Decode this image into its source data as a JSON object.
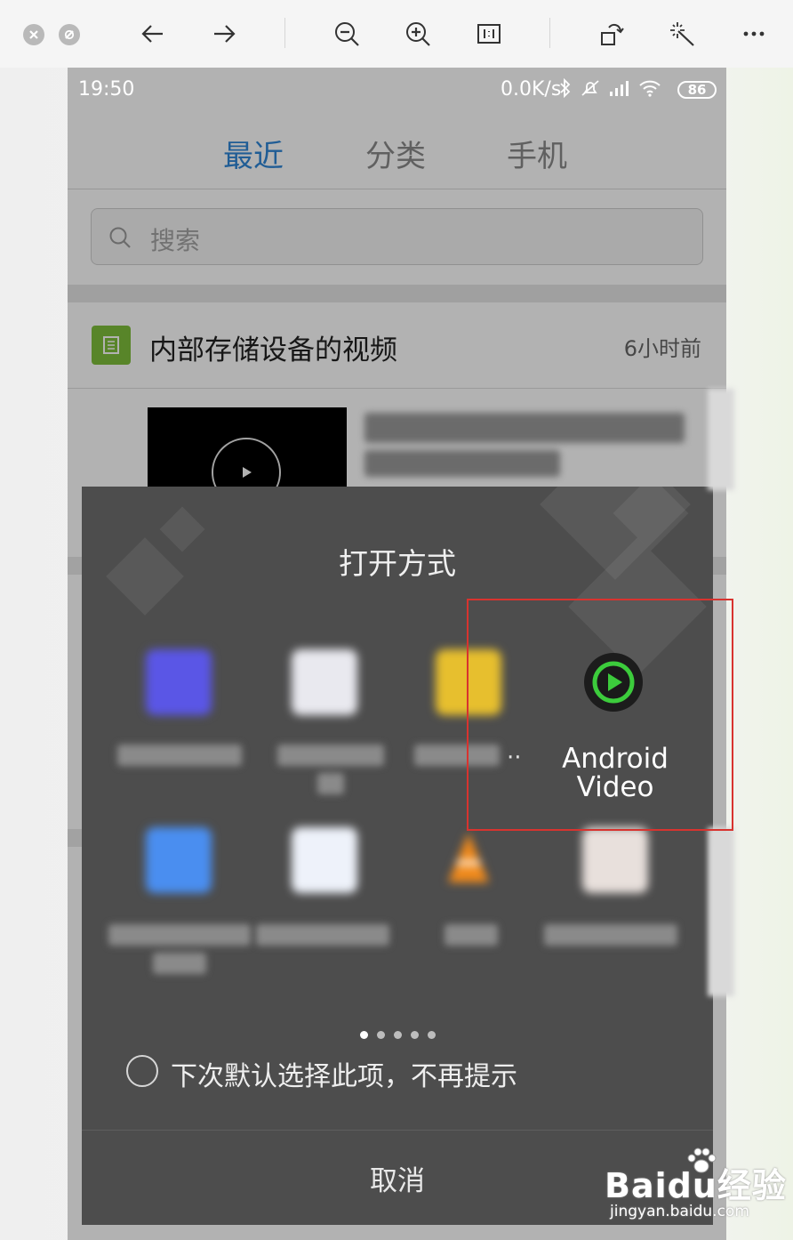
{
  "toolbar": {
    "buttons": [
      "close-icon",
      "stop-icon",
      "back-arrow-icon",
      "forward-arrow-icon",
      "zoom-out-icon",
      "zoom-in-icon",
      "actual-size-icon",
      "rotate-icon",
      "magic-wand-icon",
      "more-icon"
    ]
  },
  "status_bar": {
    "time": "19:50",
    "speed": "0.0K/s",
    "battery": "86"
  },
  "tabs": [
    {
      "label": "最近",
      "active": true
    },
    {
      "label": "分类",
      "active": false
    },
    {
      "label": "手机",
      "active": false
    }
  ],
  "search": {
    "placeholder": "搜索"
  },
  "group": {
    "title": "内部存储设备的视频",
    "time": "6小时前"
  },
  "dialog": {
    "title": "打开方式",
    "apps": [
      {
        "label": "Android Video",
        "icon": "play-circle-icon",
        "color": "#3ccc3c"
      }
    ],
    "ellipsis": "··",
    "remember_label": "下次默认选择此项，不再提示",
    "cancel_label": "取消",
    "page_count": 5,
    "current_page": 1
  },
  "colors": {
    "accent": "#2f86d6",
    "highlight": "#d8332f",
    "dialog_bg": "#4d4d4d"
  },
  "watermark": {
    "brand": "Bai",
    "brand2": "du",
    "brand3": "经验",
    "url": "jingyan.baidu.com"
  }
}
